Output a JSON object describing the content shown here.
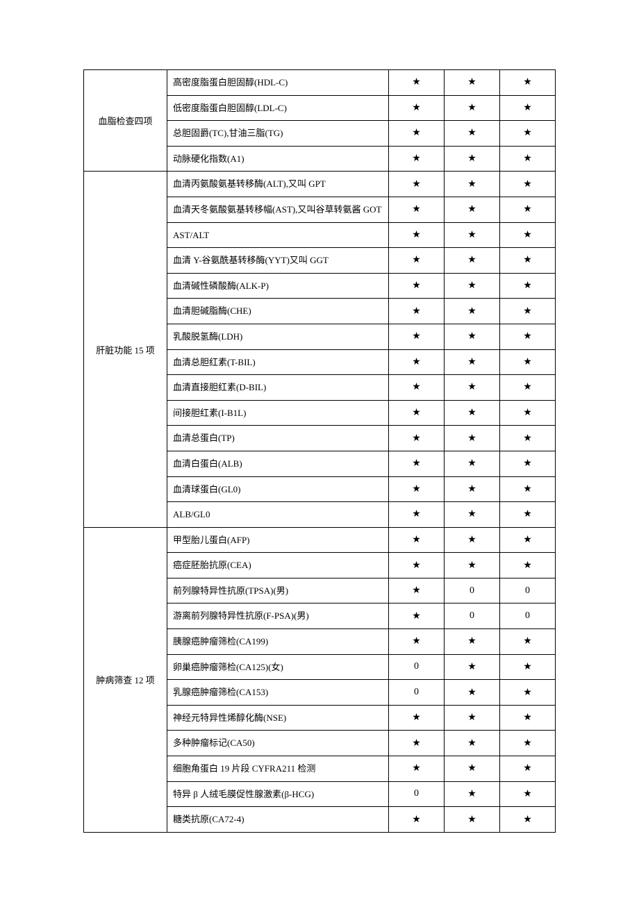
{
  "groups": [
    {
      "category": "血脂检查四项",
      "rows": [
        {
          "item": "高密度脂蛋白胆固醇(HDL-C)",
          "c": [
            "★",
            "★",
            "★"
          ]
        },
        {
          "item": "低密度脂蛋白胆固醇(LDL-C)",
          "c": [
            "★",
            "★",
            "★"
          ]
        },
        {
          "item": "总胆固爵(TC),甘油三脂(TG)",
          "c": [
            "★",
            "★",
            "★"
          ]
        },
        {
          "item": "动脉硬化指数(A1)",
          "c": [
            "★",
            "★",
            "★"
          ]
        }
      ]
    },
    {
      "category": "肝脏功能 15 项",
      "rows": [
        {
          "item": "血清丙氨酸氨基转移酶(ALT),又叫 GPT",
          "c": [
            "★",
            "★",
            "★"
          ]
        },
        {
          "item": "血清天冬氨酸氨基转移幅(AST),又叫谷草转氨酱 GOT",
          "c": [
            "★",
            "★",
            "★"
          ]
        },
        {
          "item": "AST/ALT",
          "c": [
            "★",
            "★",
            "★"
          ]
        },
        {
          "item": "血清 Y-谷氨酰基转移酶(YYT)又叫 GGT",
          "c": [
            "★",
            "★",
            "★"
          ]
        },
        {
          "item": "血清碱性磷酸酶(ALK-P)",
          "c": [
            "★",
            "★",
            "★"
          ]
        },
        {
          "item": "血清胆碱脂酶(CHE)",
          "c": [
            "★",
            "★",
            "★"
          ]
        },
        {
          "item": "乳酸脱氢酶(LDH)",
          "c": [
            "★",
            "★",
            "★"
          ]
        },
        {
          "item": "血清总胆红素(T-BIL)",
          "c": [
            "★",
            "★",
            "★"
          ]
        },
        {
          "item": "血清直接胆红素(D-BIL)",
          "c": [
            "★",
            "★",
            "★"
          ]
        },
        {
          "item": "间接胆红素(I-B1L)",
          "c": [
            "★",
            "★",
            "★"
          ]
        },
        {
          "item": "血清总蛋白(TP)",
          "c": [
            "★",
            "★",
            "★"
          ]
        },
        {
          "item": "血清白蛋白(ALB)",
          "c": [
            "★",
            "★",
            "★"
          ]
        },
        {
          "item": "血清球蛋白(GL0)",
          "c": [
            "★",
            "★",
            "★"
          ]
        },
        {
          "item": "ALB/GL0",
          "c": [
            "★",
            "★",
            "★"
          ]
        }
      ]
    },
    {
      "category": "肿病筛查 12 项",
      "rows": [
        {
          "item": "甲型胎儿蛋白(AFP)",
          "c": [
            "★",
            "★",
            "★"
          ]
        },
        {
          "item": "癌症胚胎抗原(CEA)",
          "c": [
            "★",
            "★",
            "★"
          ]
        },
        {
          "item": "前列腺特异性抗原(TPSA)(男)",
          "c": [
            "★",
            "0",
            "0"
          ]
        },
        {
          "item": "游离前列腺特异性抗原(F-PSA)(男)",
          "c": [
            "★",
            "0",
            "0"
          ]
        },
        {
          "item": "胰腺癌肿瘤筛检(CA199)",
          "c": [
            "★",
            "★",
            "★"
          ]
        },
        {
          "item": "卵巢癌肿瘤筛检(CA125)(女)",
          "c": [
            "0",
            "★",
            "★"
          ]
        },
        {
          "item": "乳腺癌肿瘤筛检(CA153)",
          "c": [
            "0",
            "★",
            "★"
          ]
        },
        {
          "item": "神经元特异性烯醇化酶(NSE)",
          "c": [
            "★",
            "★",
            "★"
          ]
        },
        {
          "item": "多种肿瘤标记(CA50)",
          "c": [
            "★",
            "★",
            "★"
          ]
        },
        {
          "item": "细胞角蛋白 19 片段 CYFRA211 检测",
          "c": [
            "★",
            "★",
            "★"
          ]
        },
        {
          "item": "特异 β 人绒毛膜促性腺激素(β-HCG)",
          "c": [
            "0",
            "★",
            "★"
          ]
        },
        {
          "item": "糖类抗原(CA72-4)",
          "c": [
            "★",
            "★",
            "★"
          ]
        }
      ]
    }
  ]
}
